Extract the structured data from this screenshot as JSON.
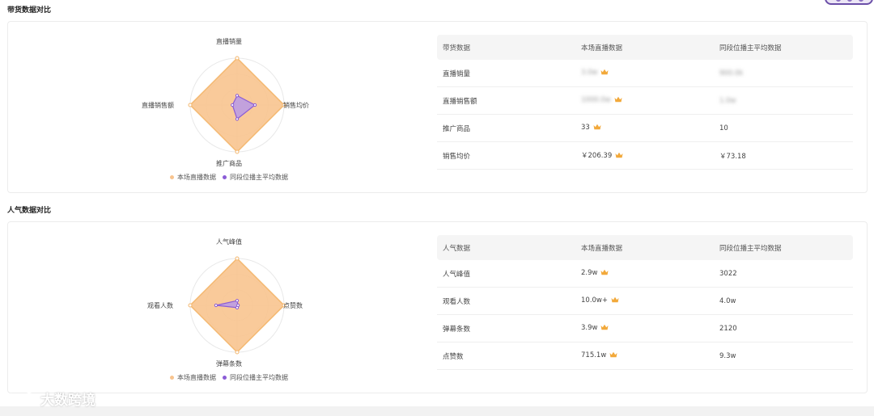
{
  "sales_section": {
    "title": "带货数据对比",
    "radar": {
      "axes": [
        "直播销量",
        "销售均价",
        "推广商品",
        "直播销售额"
      ],
      "legend": [
        "本场直播数据",
        "同段位播主平均数据"
      ],
      "current_values": [
        1,
        1,
        1,
        1
      ],
      "average_values": [
        0.2,
        0.38,
        0.3,
        0.1
      ]
    },
    "table": {
      "headers": [
        "带货数据",
        "本场直播数据",
        "同段位播主平均数据"
      ],
      "rows": [
        {
          "metric": "直播销量",
          "current": "3.0w",
          "average": "900.0k"
        },
        {
          "metric": "直播销售额",
          "current": "1000.0w",
          "average": "1.0w"
        },
        {
          "metric": "推广商品",
          "current": "33",
          "average": "10"
        },
        {
          "metric": "销售均价",
          "current": "￥206.39",
          "average": "￥73.18"
        }
      ]
    }
  },
  "popularity_section": {
    "title": "人气数据对比",
    "radar": {
      "axes": [
        "人气峰值",
        "点赞数",
        "弹幕条数",
        "观看人数"
      ],
      "legend": [
        "本场直播数据",
        "同段位播主平均数据"
      ],
      "current_values": [
        1,
        1,
        1,
        1
      ],
      "average_values": [
        0.1,
        0.02,
        0.05,
        0.45
      ]
    },
    "table": {
      "headers": [
        "人气数据",
        "本场直播数据",
        "同段位播主平均数据"
      ],
      "rows": [
        {
          "metric": "人气峰值",
          "current": "2.9w",
          "average": "3022"
        },
        {
          "metric": "观看人数",
          "current": "10.0w+",
          "average": "4.0w"
        },
        {
          "metric": "弹幕条数",
          "current": "3.9w",
          "average": "2120"
        },
        {
          "metric": "点赞数",
          "current": "715.1w",
          "average": "9.3w"
        }
      ]
    }
  },
  "watermark": {
    "text": "大数跨境"
  },
  "colors": {
    "current_fill": "#f8c48f",
    "current_stroke": "#f4b870",
    "average_fill": "#b99ae8",
    "average_stroke": "#8b5cd6",
    "crown": "#f2a93b",
    "grid": "#e8e8e8"
  }
}
